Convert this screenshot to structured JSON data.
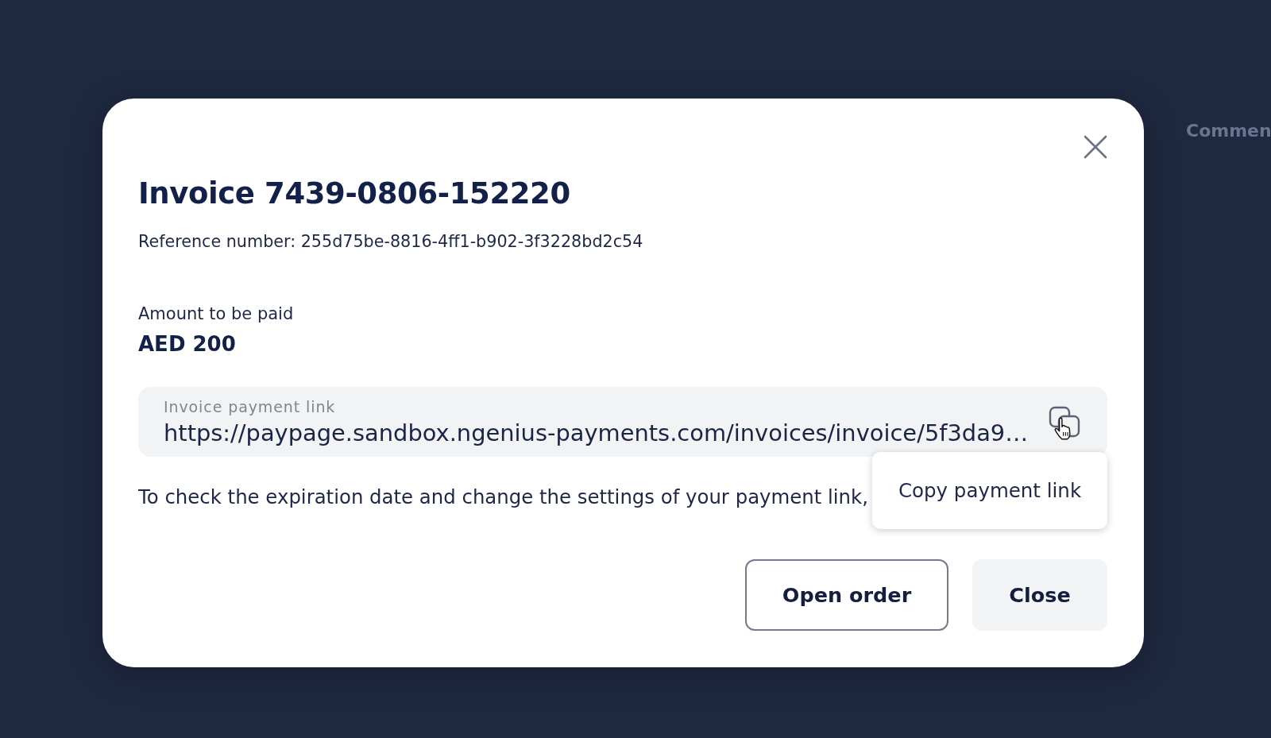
{
  "modal": {
    "title": "Invoice 7439-0806-152220",
    "reference": "Reference number: 255d75be-8816-4ff1-b902-3f3228bd2c54",
    "amount_label": "Amount to be paid",
    "amount": "AED 200",
    "link_field": {
      "label": "Invoice payment link",
      "value": "https://paypage.sandbox.ngenius-payments.com/invoices/invoice/5f3da9…"
    },
    "tooltip": "Copy payment link",
    "note": "To check the expiration date and change the settings of your payment link,",
    "buttons": [
      {
        "label": "Open order",
        "kind": "outline"
      },
      {
        "label": "Close",
        "kind": "filled"
      }
    ]
  },
  "background": {
    "text": "Commen"
  }
}
